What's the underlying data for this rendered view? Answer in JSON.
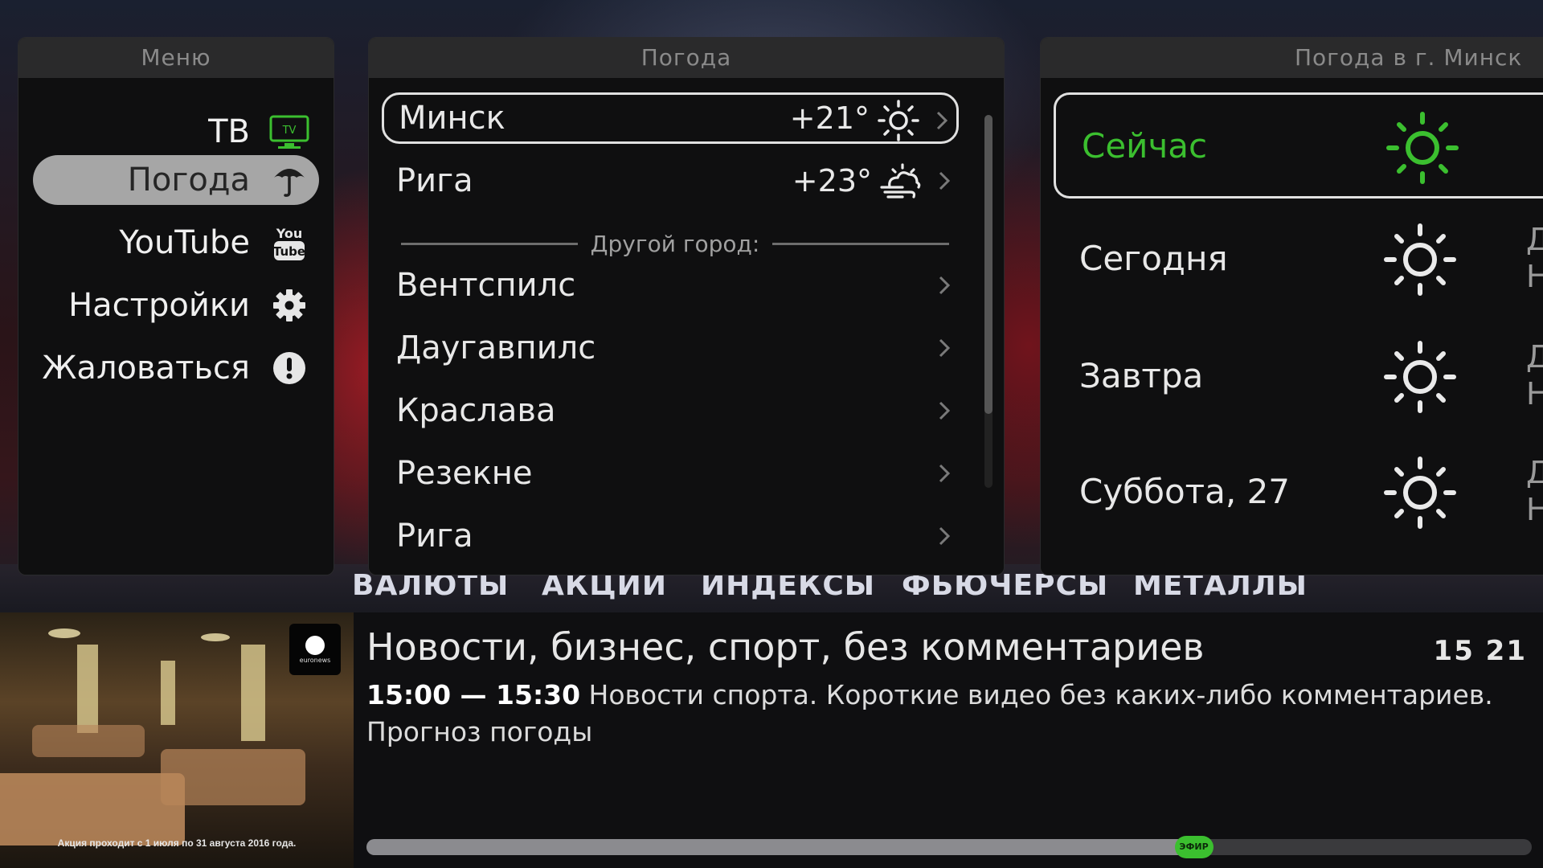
{
  "menu": {
    "title": "Меню",
    "items": [
      {
        "label": "ТВ",
        "icon": "tv-icon",
        "icon_text": "TV"
      },
      {
        "label": "Погода",
        "icon": "umbrella-icon",
        "active": true
      },
      {
        "label": "YouTube",
        "icon": "youtube-icon",
        "icon_text_top": "You",
        "icon_text_bottom": "Tube"
      },
      {
        "label": "Настройки",
        "icon": "gear-icon"
      },
      {
        "label": "Жаловаться",
        "icon": "exclamation-icon"
      }
    ]
  },
  "weather": {
    "title": "Погода",
    "favorites": [
      {
        "city": "Минск",
        "temp": "+21°",
        "icon": "sun-icon",
        "selected": true
      },
      {
        "city": "Рига",
        "temp": "+23°",
        "icon": "cloud-wind-icon"
      }
    ],
    "other_label": "Другой город:",
    "cities": [
      "Вентспилс",
      "Даугавпилс",
      "Краслава",
      "Резекне",
      "Рига"
    ]
  },
  "forecast": {
    "title": "Погода в г. Минск",
    "items": [
      {
        "label": "Сейчас",
        "icon": "sun-icon",
        "selected": true,
        "cut_text": ""
      },
      {
        "label": "Сегодня",
        "icon": "sun-icon",
        "cut_text": "Д\nН"
      },
      {
        "label": "Завтра",
        "icon": "sun-icon",
        "cut_text": "Д\nН"
      },
      {
        "label": "Суббота, 27",
        "icon": "sun-icon",
        "cut_text": "Д\nН"
      }
    ]
  },
  "ticker": [
    "ВАЛЮТЫ",
    "АКЦИИ",
    "ИНДЕКСЫ",
    "ФЬЮЧЕРСЫ",
    "МЕТАЛЛЫ"
  ],
  "program": {
    "channel_logo_text": "euronews",
    "title": "Новости, бизнес, спорт, без комментариев",
    "clock": "15 21",
    "time_range": "15:00 — 15:30",
    "description": " Новости спорта. Короткие видео без каких-либо комментариев. Прогноз погоды",
    "progress_fraction": 0.71,
    "live_label": "ЭФИР",
    "thumbnail_caption": "Акция проходит с 1 июля по 31 августа 2016 года."
  },
  "colors": {
    "accent_green": "#3bbf2f",
    "active_pill": "#a6a6a6",
    "panel_bg": "#0f0f10",
    "panel_header": "#2a2a2b"
  }
}
